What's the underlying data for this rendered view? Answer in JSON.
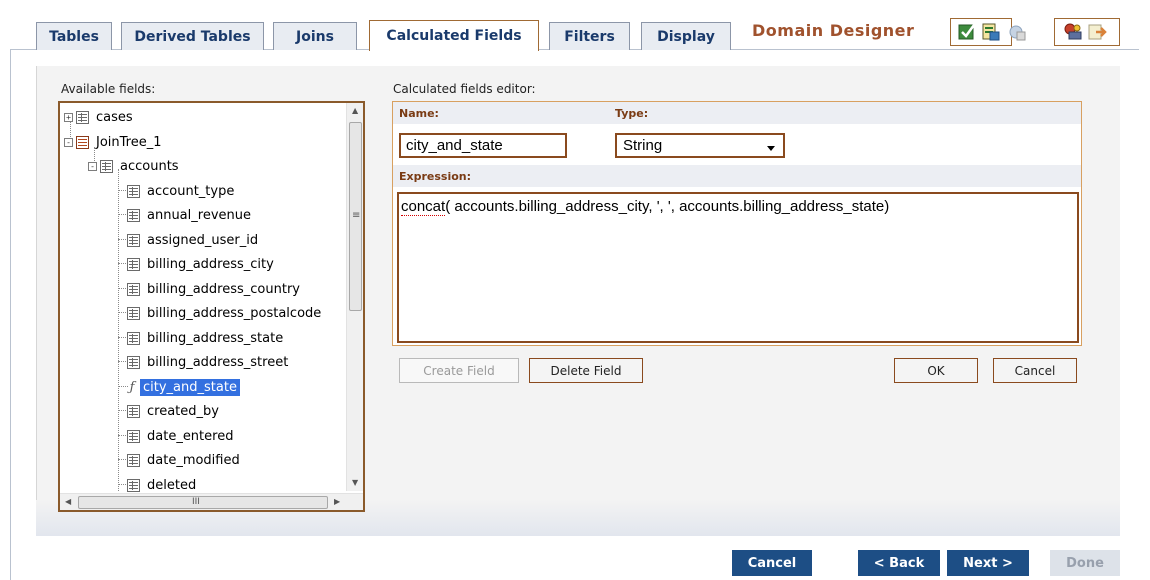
{
  "tabs": [
    {
      "label": "Tables",
      "active": false
    },
    {
      "label": "Derived Tables",
      "active": false
    },
    {
      "label": "Joins",
      "active": false
    },
    {
      "label": "Calculated Fields",
      "active": true
    },
    {
      "label": "Filters",
      "active": false
    },
    {
      "label": "Display",
      "active": false
    }
  ],
  "app_title": "Domain Designer",
  "toolbar_icons": [
    "check-table-icon",
    "table-properties-icon",
    "refresh-icon",
    "user-key-icon",
    "export-icon"
  ],
  "available_fields": {
    "label": "Available fields:",
    "tree": [
      {
        "label": "cases",
        "icon": "table-icon",
        "expander": "+"
      },
      {
        "label": "JoinTree_1",
        "icon": "join-tree-icon",
        "expander": "-"
      },
      {
        "label": "accounts",
        "icon": "table-icon",
        "expander": "-"
      },
      {
        "label": "account_type",
        "icon": "field-icon"
      },
      {
        "label": "annual_revenue",
        "icon": "field-icon"
      },
      {
        "label": "assigned_user_id",
        "icon": "field-icon"
      },
      {
        "label": "billing_address_city",
        "icon": "field-icon"
      },
      {
        "label": "billing_address_country",
        "icon": "field-icon"
      },
      {
        "label": "billing_address_postalcode",
        "icon": "field-icon"
      },
      {
        "label": "billing_address_state",
        "icon": "field-icon"
      },
      {
        "label": "billing_address_street",
        "icon": "field-icon"
      },
      {
        "label": "city_and_state",
        "icon": "function-icon",
        "selected": true
      },
      {
        "label": "created_by",
        "icon": "field-icon"
      },
      {
        "label": "date_entered",
        "icon": "field-icon"
      },
      {
        "label": "date_modified",
        "icon": "field-icon"
      },
      {
        "label": "deleted",
        "icon": "field-icon"
      }
    ]
  },
  "editor": {
    "label": "Calculated fields editor:",
    "name_label": "Name:",
    "type_label": "Type:",
    "name_value": "city_and_state",
    "type_value": "String",
    "expression_label": "Expression:",
    "expression_prefix": "concat",
    "expression_rest": "( accounts.billing_address_city, ', ', accounts.billing_address_state)"
  },
  "buttons": {
    "create_field": "Create Field",
    "delete_field": "Delete Field",
    "ok": "OK",
    "cancel_small": "Cancel"
  },
  "nav": {
    "cancel": "Cancel",
    "back": "< Back",
    "next": "Next >",
    "done": "Done"
  },
  "scrollbar_glyphs": {
    "h_grip": "III",
    "v_grip": "≡"
  },
  "colors": {
    "accent": "#a0522d",
    "nav_button": "#1d4e85",
    "selection": "#3370e0",
    "border_brown": "#8a4a1e"
  }
}
